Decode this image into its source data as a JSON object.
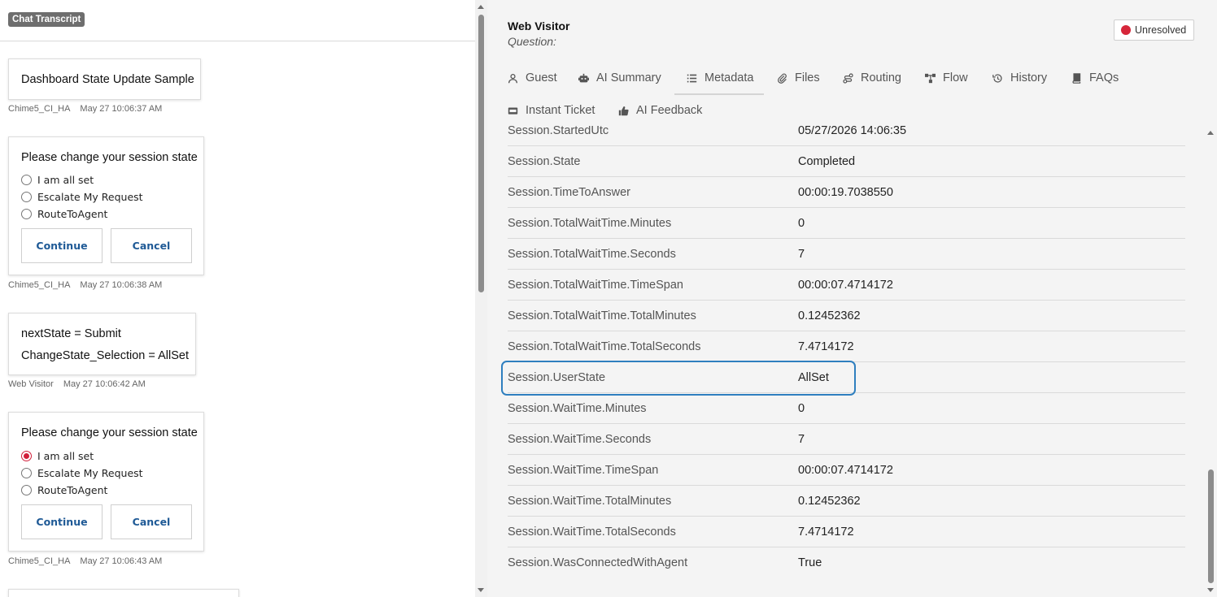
{
  "transcript": {
    "badge": "Chat Transcript",
    "messages": [
      {
        "text": "Dashboard State Update Sample",
        "sender": "Chime5_CI_HA",
        "time": "May 27 10:06:37 AM"
      },
      {
        "prompt": "Please change your session state",
        "options": [
          "I am all set",
          "Escalate My Request",
          "RouteToAgent"
        ],
        "selected": null,
        "continue_label": "Continue",
        "cancel_label": "Cancel",
        "sender": "Chime5_CI_HA",
        "time": "May 27 10:06:38 AM"
      },
      {
        "lines": [
          "nextState = Submit",
          "ChangeState_Selection = AllSet"
        ],
        "sender": "Web Visitor",
        "time": "May 27 10:06:42 AM"
      },
      {
        "prompt": "Please change your session state",
        "options": [
          "I am all set",
          "Escalate My Request",
          "RouteToAgent"
        ],
        "selected": "I am all set",
        "continue_label": "Continue",
        "cancel_label": "Cancel",
        "sender": "Chime5_CI_HA",
        "time": "May 27 10:06:43 AM"
      }
    ]
  },
  "details": {
    "visitor_name": "Web Visitor",
    "question_label": "Question:",
    "status": {
      "label": "Unresolved",
      "color": "#d6263a"
    },
    "tabs": [
      {
        "label": "Guest",
        "icon": "person-icon"
      },
      {
        "label": "AI Summary",
        "icon": "robot-icon"
      },
      {
        "label": "Metadata",
        "icon": "list-icon",
        "active": true
      },
      {
        "label": "Files",
        "icon": "paperclip-icon"
      },
      {
        "label": "Routing",
        "icon": "routing-icon"
      },
      {
        "label": "Flow",
        "icon": "flow-icon"
      },
      {
        "label": "History",
        "icon": "history-icon"
      },
      {
        "label": "FAQs",
        "icon": "book-icon"
      },
      {
        "label": "Instant Ticket",
        "icon": "ticket-icon"
      },
      {
        "label": "AI Feedback",
        "icon": "thumbs-up-icon"
      }
    ],
    "metadata": [
      {
        "key": "Session.StartedUtc",
        "value": "05/27/2026 14:06:35"
      },
      {
        "key": "Session.State",
        "value": "Completed"
      },
      {
        "key": "Session.TimeToAnswer",
        "value": "00:00:19.7038550"
      },
      {
        "key": "Session.TotalWaitTime.Minutes",
        "value": "0"
      },
      {
        "key": "Session.TotalWaitTime.Seconds",
        "value": "7"
      },
      {
        "key": "Session.TotalWaitTime.TimeSpan",
        "value": "00:00:07.4714172"
      },
      {
        "key": "Session.TotalWaitTime.TotalMinutes",
        "value": "0.12452362"
      },
      {
        "key": "Session.TotalWaitTime.TotalSeconds",
        "value": "7.4714172"
      },
      {
        "key": "Session.UserState",
        "value": "AllSet",
        "highlighted": true
      },
      {
        "key": "Session.WaitTime.Minutes",
        "value": "0"
      },
      {
        "key": "Session.WaitTime.Seconds",
        "value": "7"
      },
      {
        "key": "Session.WaitTime.TimeSpan",
        "value": "00:00:07.4714172"
      },
      {
        "key": "Session.WaitTime.TotalMinutes",
        "value": "0.12452362"
      },
      {
        "key": "Session.WaitTime.TotalSeconds",
        "value": "7.4714172"
      },
      {
        "key": "Session.WasConnectedWithAgent",
        "value": "True"
      }
    ]
  },
  "colors": {
    "accent_blue": "#1f5a96",
    "highlight_border": "#2f7fbf",
    "radio_selected": "#d11f3a"
  }
}
